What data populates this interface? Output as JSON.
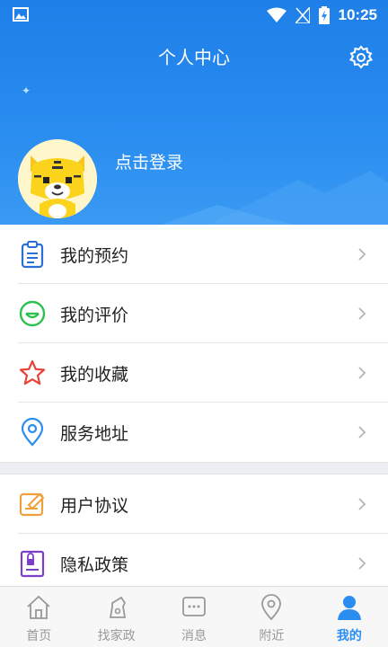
{
  "status": {
    "time": "10:25"
  },
  "header": {
    "title": "个人中心",
    "login": "点击登录"
  },
  "menu": [
    {
      "label": "我的预约",
      "icon": "clipboard-icon",
      "color": "#2b6fd6"
    },
    {
      "label": "我的评价",
      "icon": "smile-icon",
      "color": "#2cc14e"
    },
    {
      "label": "我的收藏",
      "icon": "star-icon",
      "color": "#e8433a"
    },
    {
      "label": "服务地址",
      "icon": "location-pin-icon",
      "color": "#2a8df0"
    },
    {
      "label": "用户协议",
      "icon": "agreement-icon",
      "color": "#f0a03a"
    },
    {
      "label": "隐私政策",
      "icon": "privacy-icon",
      "color": "#7b3fc8"
    }
  ],
  "tabs": [
    {
      "label": "首页",
      "icon": "home-icon"
    },
    {
      "label": "找家政",
      "icon": "housekeeping-icon"
    },
    {
      "label": "消息",
      "icon": "message-icon"
    },
    {
      "label": "附近",
      "icon": "nearby-icon"
    },
    {
      "label": "我的",
      "icon": "profile-icon",
      "active": true
    }
  ],
  "colors": {
    "accent": "#2a8df0",
    "inactive": "#999999"
  }
}
